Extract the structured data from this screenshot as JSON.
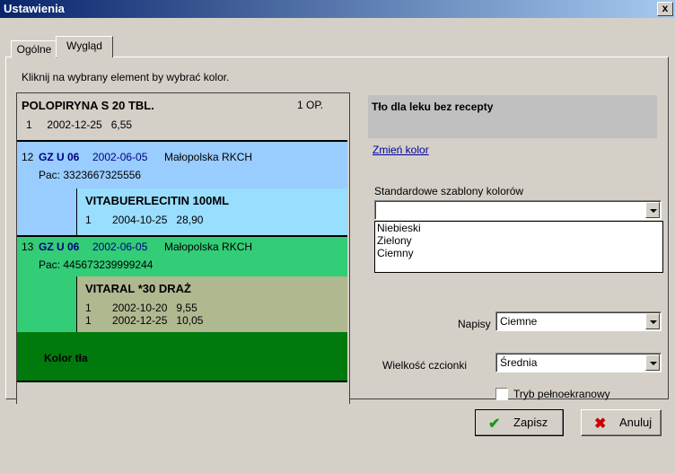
{
  "window": {
    "title": "Ustawienia",
    "close_label": "x"
  },
  "tabs": [
    {
      "label": "Ogólne"
    },
    {
      "label": "Wygląd"
    }
  ],
  "hint": "Kliknij na wybrany element by wybrać kolor.",
  "preview": {
    "item1": {
      "name": "POLOPIRYNA S 20 TBL.",
      "qty": "1 OP.",
      "line": "1     2002-12-25   6,55"
    },
    "rx1": {
      "num": "12",
      "code": "GZ U 06",
      "date": "2002-06-05",
      "source": "Małopolska RKCH",
      "pac": "Pac: 3323667325556"
    },
    "item2": {
      "name": "VITABUERLECITIN 100ML",
      "line": "1       2004-10-25   28,90"
    },
    "rx2": {
      "num": "13",
      "code": "GZ U 06",
      "date": "2002-06-05",
      "source": "Małopolska RKCH",
      "pac": "Pac: 445673239999244"
    },
    "item3": {
      "name": "VITARAL *30 DRAŻ",
      "line1": "1       2002-10-20   9,55",
      "line2": "1       2002-12-25   10,05"
    },
    "bg_label": "Kolor tła"
  },
  "colors": {
    "rx1_bg": "#99ccff",
    "item2_bg": "#99ddff",
    "rx2_bg": "#33cc77",
    "item3_bg": "#b0b890",
    "bg_dark": "#007a0c"
  },
  "right": {
    "element_name": "Tło dla leku bez recepty",
    "change_color_link": "Zmień kolor",
    "templates_label": "Standardowe szablony kolorów",
    "templates_value": "",
    "templates_options": [
      "Niebieski",
      "Zielony",
      "Ciemny"
    ],
    "captions_label": "Napisy",
    "captions_value": "Ciemne",
    "fontsize_label": "Wielkość czcionki",
    "fontsize_value": "Średnia",
    "fullscreen_label": "Tryb pełnoekranowy"
  },
  "buttons": {
    "save": "Zapisz",
    "cancel": "Anuluj"
  }
}
